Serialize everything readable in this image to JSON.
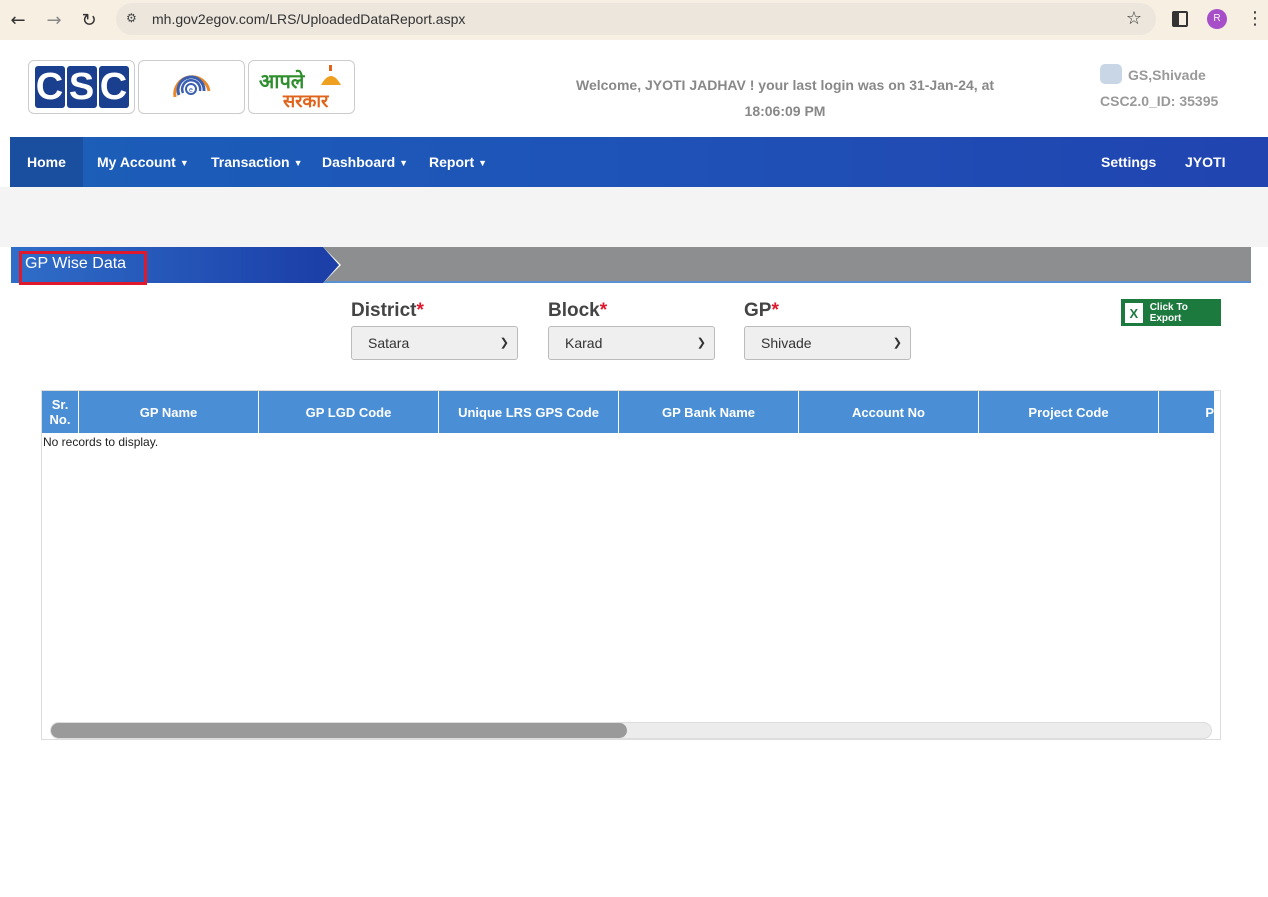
{
  "browser": {
    "url": "mh.gov2egov.com/LRS/UploadedDataReport.aspx",
    "profile_initial": "R",
    "icons": [
      "back-icon",
      "forward-icon",
      "reload-icon",
      "site-info-icon",
      "bookmark-star-icon",
      "side-panel-icon",
      "menu-icon"
    ]
  },
  "header": {
    "welcome_line1": "Welcome, JYOTI JADHAV ! your last login was on 31-Jan-24, at",
    "welcome_line2": "18:06:09 PM",
    "user_name": "GS,Shivade",
    "user_id": "CSC2.0_ID: 35395",
    "logo_csc": [
      "C",
      "S",
      "C"
    ],
    "logo_aple_line1": "आपले",
    "logo_aple_line2": "सरकार"
  },
  "nav": {
    "home": "Home",
    "my_account": "My Account",
    "transaction": "Transaction",
    "dashboard": "Dashboard",
    "report": "Report",
    "settings": "Settings",
    "user": "JYOTI"
  },
  "section": {
    "title": "GP Wise Data"
  },
  "filters": {
    "district_label": "District",
    "district_value": "Satara",
    "block_label": "Block",
    "block_value": "Karad",
    "gp_label": "GP",
    "gp_value": "Shivade",
    "required_mark": "*"
  },
  "export": {
    "label": "Click To Export",
    "icon": "X"
  },
  "grid": {
    "columns": [
      "Sr. No.",
      "GP Name",
      "GP LGD Code",
      "Unique LRS GPS Code",
      "GP Bank Name",
      "Account No",
      "Project Code",
      "P"
    ],
    "empty_text": "No records to display."
  },
  "colors": {
    "nav_blue": "#1e55b8",
    "grid_header": "#4a8fd6",
    "export_green": "#1d7a3e",
    "required_red": "#e0182c",
    "highlight_red": "#e0182c"
  }
}
